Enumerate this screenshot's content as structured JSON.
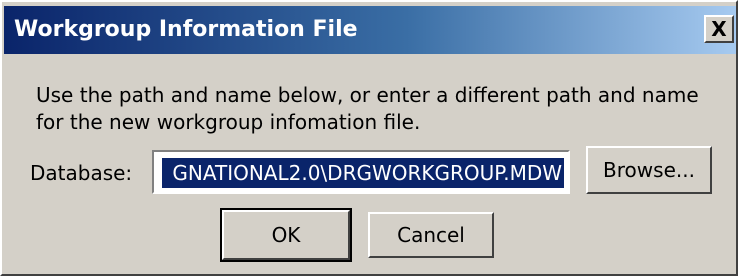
{
  "dialog": {
    "title": "Workgroup Information File",
    "close_label": "X",
    "message": "Use the path and name below, or enter a different path and name for the new workgroup infomation file.",
    "database_label": "Database:",
    "database_value": "GNATIONAL2.0\\DRGWORKGROUP.MDW",
    "browse_label": "Browse...",
    "ok_label": "OK",
    "cancel_label": "Cancel"
  },
  "colors": {
    "title_bar_start": "#0a246a",
    "title_bar_end": "#a6caf0",
    "dialog_face": "#d4d0c8",
    "selection": "#0a246a"
  },
  "icons": {
    "close": "close-icon"
  }
}
